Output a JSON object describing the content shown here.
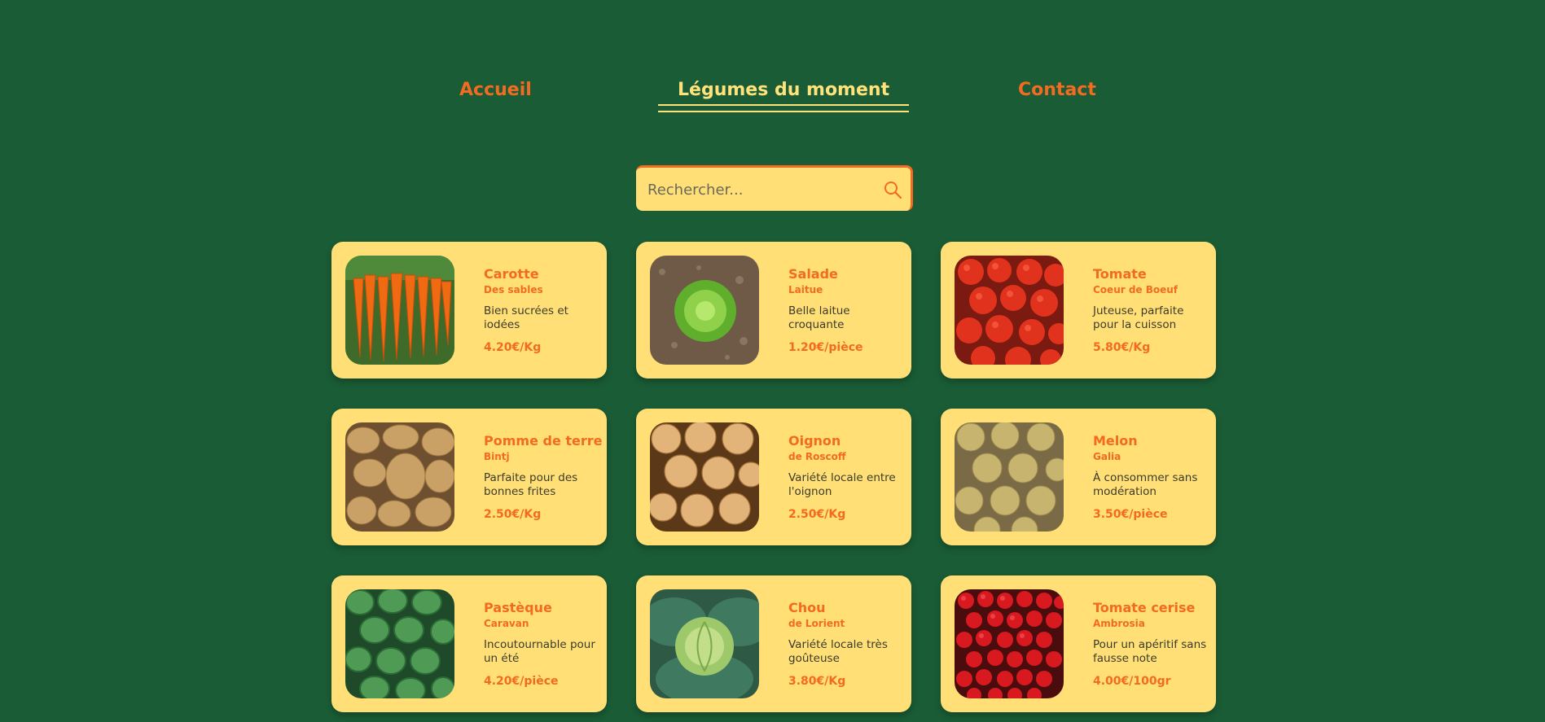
{
  "nav": {
    "items": [
      {
        "label": "Accueil",
        "active": false
      },
      {
        "label": "Légumes du moment",
        "active": true
      },
      {
        "label": "Contact",
        "active": false
      }
    ]
  },
  "search": {
    "placeholder": "Rechercher...",
    "icon": "search-icon"
  },
  "colors": {
    "background": "#1a5c36",
    "card": "#ffdf76",
    "accent": "#f26b21",
    "active": "#ffe27a"
  },
  "products": [
    {
      "name": "Carotte",
      "variety": "Des sables",
      "description": "Bien sucrées et iodées",
      "price": "4.20€/Kg",
      "image": "carrots-photo"
    },
    {
      "name": "Salade",
      "variety": "Laitue",
      "description": "Belle laitue croquante",
      "price": "1.20€/pièce",
      "image": "lettuce-photo"
    },
    {
      "name": "Tomate",
      "variety": "Coeur de Boeuf",
      "description": "Juteuse, parfaite pour la cuisson",
      "price": "5.80€/Kg",
      "image": "tomatoes-photo"
    },
    {
      "name": "Pomme de terre",
      "variety": "Bintj",
      "description": "Parfaite pour des bonnes frites",
      "price": "2.50€/Kg",
      "image": "potatoes-photo"
    },
    {
      "name": "Oignon",
      "variety": "de Roscoff",
      "description": "Variété locale entre l'oignon",
      "price": "2.50€/Kg",
      "image": "onions-photo"
    },
    {
      "name": "Melon",
      "variety": "Galia",
      "description": "À consommer sans modération",
      "price": "3.50€/pièce",
      "image": "melons-photo"
    },
    {
      "name": "Pastèque",
      "variety": "Caravan",
      "description": "Incoutournable pour un été",
      "price": "4.20€/pièce",
      "image": "watermelons-photo"
    },
    {
      "name": "Chou",
      "variety": "de Lorient",
      "description": "Variété locale très goûteuse",
      "price": "3.80€/Kg",
      "image": "cabbage-photo"
    },
    {
      "name": "Tomate cerise",
      "variety": "Ambrosia",
      "description": "Pour un apéritif sans fausse note",
      "price": "4.00€/100gr",
      "image": "cherry-tomatoes-photo"
    }
  ]
}
